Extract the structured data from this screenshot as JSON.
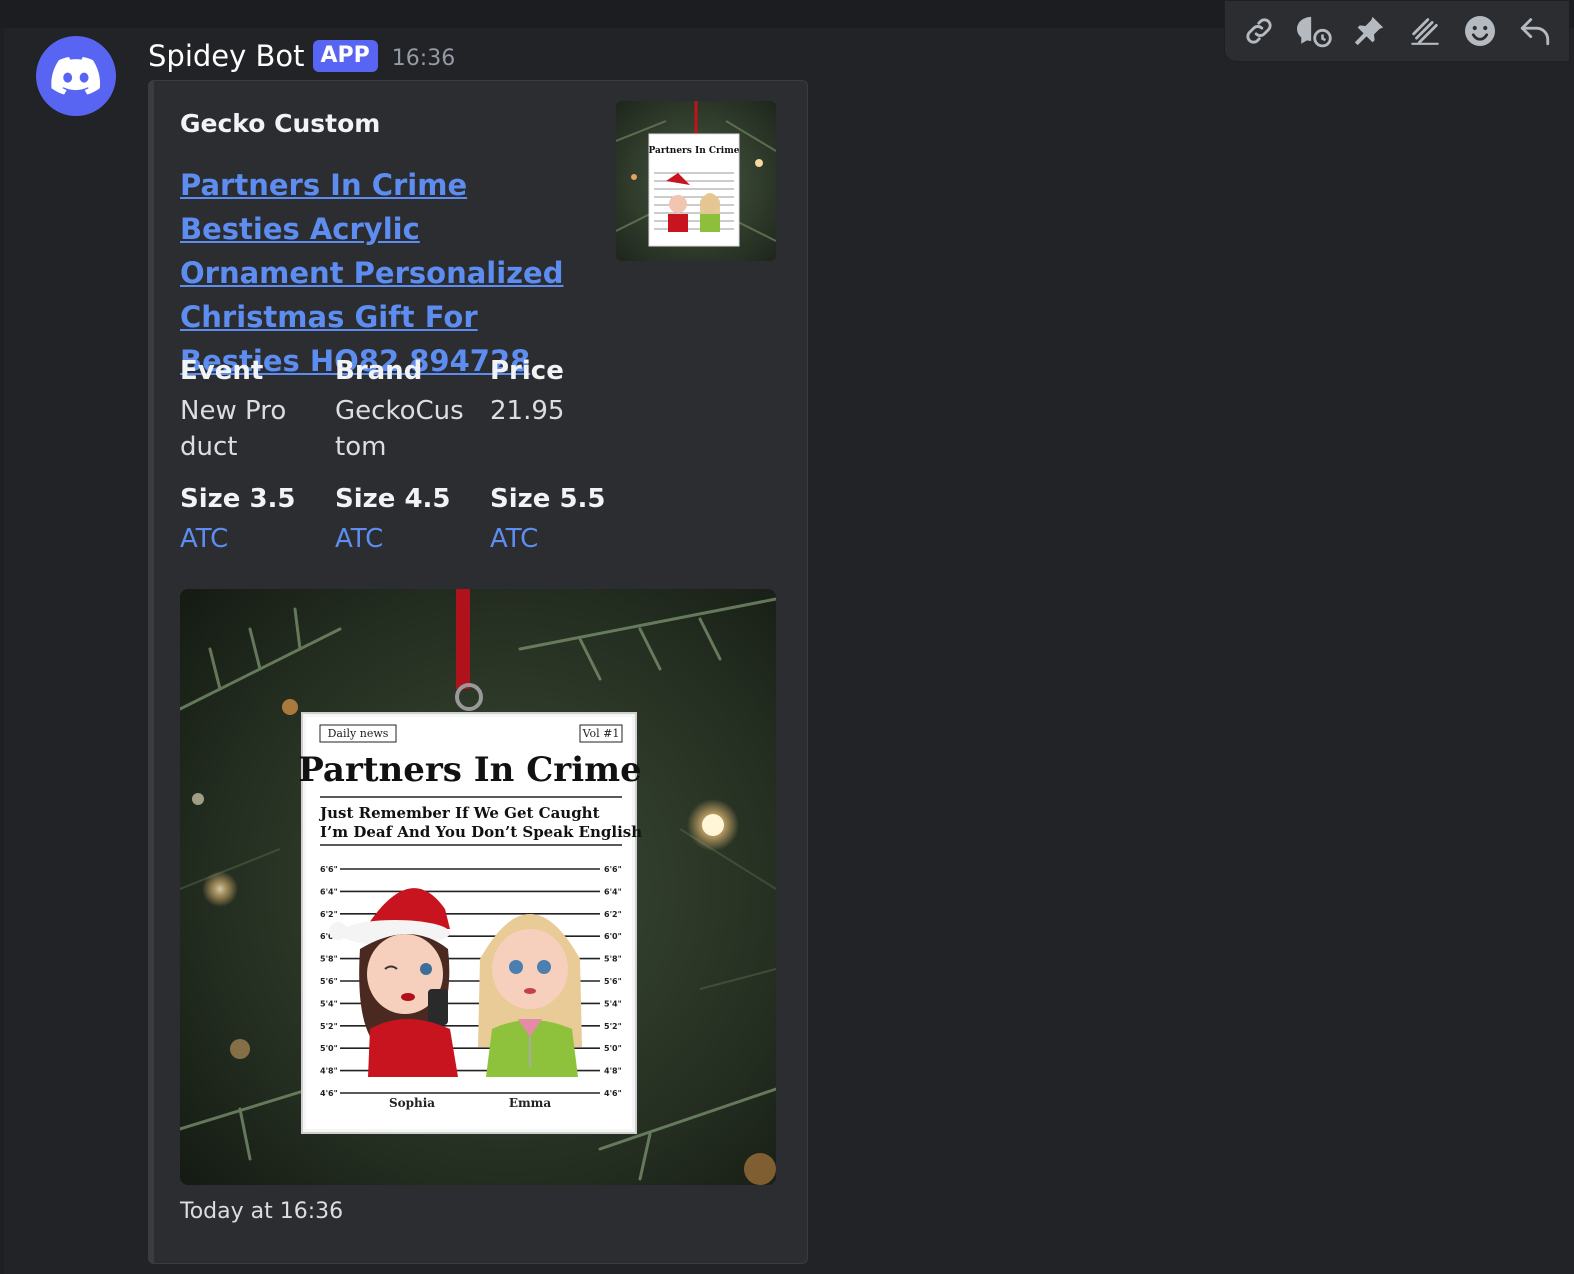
{
  "message": {
    "username": "Spidey Bot",
    "badge": "APP",
    "time": "16:36"
  },
  "embed": {
    "author": "Gecko Custom",
    "title": "Partners In Crime Besties Acrylic Ornament Personalized Christmas Gift For Besties HO82 894728",
    "fields": [
      {
        "name": "Event",
        "value": "New Product"
      },
      {
        "name": "Brand",
        "value": "GeckoCustom"
      },
      {
        "name": "Price",
        "value": "21.95"
      },
      {
        "name": "Size 3.5",
        "value": "ATC"
      },
      {
        "name": "Size 4.5",
        "value": "ATC"
      },
      {
        "name": "Size 5.5",
        "value": "ATC"
      }
    ],
    "footer": "Today at 16:36"
  },
  "ornament": {
    "tag_left": "Daily news",
    "tag_right": "Vol #1",
    "headline": "Partners In Crime",
    "subheadline_1": "Just Remember If We Get Caught",
    "subheadline_2": "I’m Deaf And You Don’t Speak English",
    "heights": [
      "6'6\"",
      "6'4\"",
      "6'2\"",
      "6'0\"",
      "5'8\"",
      "5'6\"",
      "5'4\"",
      "5'2\"",
      "5'0\"",
      "4'8\"",
      "4'6\""
    ],
    "name_1": "Sophia",
    "name_2": "Emma"
  },
  "toolbar": [
    "link-icon",
    "thread-icon",
    "pin-icon",
    "forward-icon",
    "emoji-icon",
    "reply-icon"
  ],
  "colors": {
    "accent": "#5865f2",
    "link": "#5d8df0"
  }
}
